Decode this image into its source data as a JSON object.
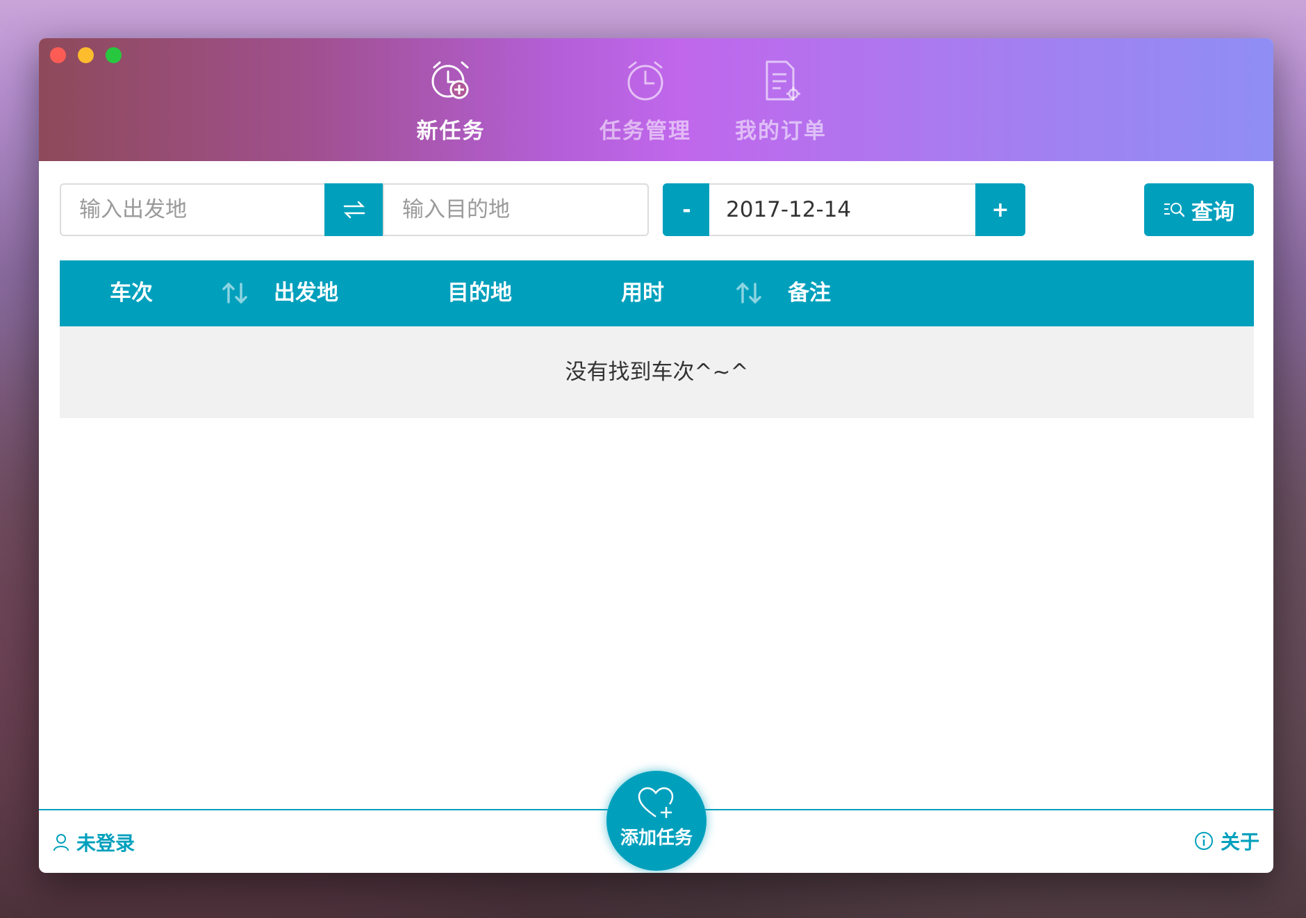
{
  "nav": {
    "tabs": [
      {
        "label": "新任务",
        "icon": "alarm-plus-icon",
        "active": true
      },
      {
        "label": "任务管理",
        "icon": "alarm-clock-icon",
        "active": false
      },
      {
        "label": "我的订单",
        "icon": "document-gear-icon",
        "active": false
      }
    ]
  },
  "search": {
    "from_placeholder": "输入出发地",
    "to_placeholder": "输入目的地",
    "swap_icon": "swap-arrows-icon",
    "date_minus": "-",
    "date_value": "2017-12-14",
    "date_plus": "+",
    "query_label": "查询",
    "query_icon": "search-list-icon"
  },
  "table": {
    "columns": [
      "车次",
      "出发地",
      "目的地",
      "用时",
      "备注"
    ],
    "empty_text": "没有找到车次^~^"
  },
  "footer": {
    "login_label": "未登录",
    "add_task_label": "添加任务",
    "about_label": "关于"
  },
  "colors": {
    "accent": "#00a0bd",
    "titlebar_gradient": [
      "#8e4a5a",
      "#c067ec",
      "#8f8ef5"
    ]
  }
}
